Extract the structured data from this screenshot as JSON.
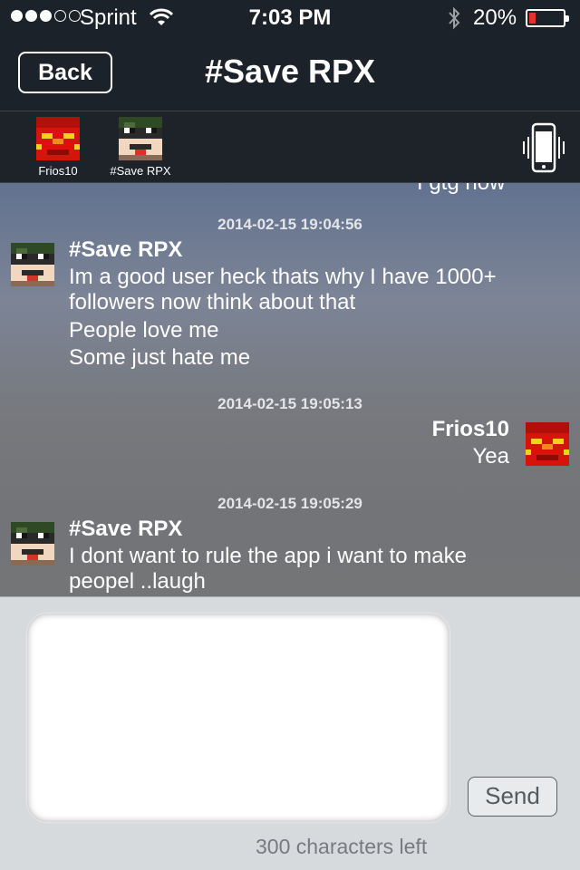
{
  "status_bar": {
    "signal_full": 3,
    "signal_empty": 2,
    "carrier": "Sprint",
    "time": "7:03 PM",
    "battery_pct_text": "20%",
    "battery_level": 0.2,
    "icons": [
      "wifi-icon",
      "bluetooth-icon",
      "battery-icon"
    ]
  },
  "nav": {
    "back_label": "Back",
    "title": "#Save RPX"
  },
  "participants": [
    {
      "name": "Frios10",
      "avatar": "red-block-avatar"
    },
    {
      "name": "#Save RPX",
      "avatar": "masked-block-avatar"
    }
  ],
  "chat": {
    "cut_text": "I gtg now",
    "groups": [
      {
        "timestamp": "2014-02-15 19:04:56",
        "sender": "#Save RPX",
        "side": "left",
        "messages": [
          "Im a good user heck thats why I have 1000+ followers now think about that",
          "People love me",
          "Some just hate me"
        ]
      },
      {
        "timestamp": "2014-02-15 19:05:13",
        "sender": "Frios10",
        "side": "right",
        "messages": [
          "Yea"
        ]
      },
      {
        "timestamp": "2014-02-15 19:05:29",
        "sender": "#Save RPX",
        "side": "left",
        "messages": [
          "I dont want to rule the app i want to make peopel ..laugh"
        ]
      }
    ]
  },
  "composer": {
    "input_value": "",
    "send_label": "Send",
    "chars_left": "300 characters left"
  },
  "colors": {
    "bar_bg": "#1c2229",
    "battery_low": "#e5322d",
    "composer_bg": "#d7dadd"
  }
}
